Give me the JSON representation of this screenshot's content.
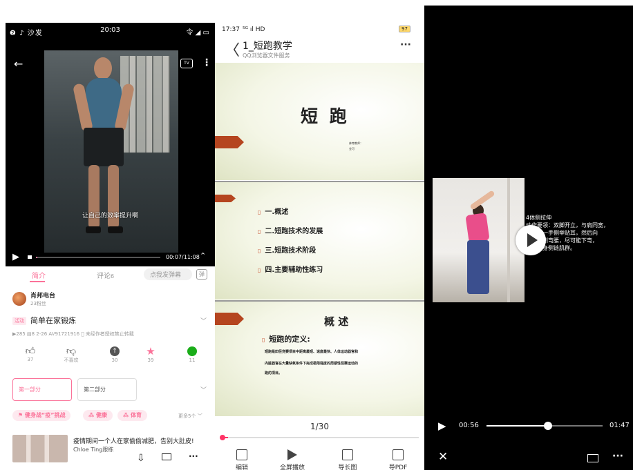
{
  "panel1": {
    "status": {
      "left": "❷ ♪  沙发",
      "time": "20:03",
      "right": "令 ◢ ▭"
    },
    "tv_label": "TV",
    "subtitle": "让自己的效率提升啊",
    "time_display": "00:07/11:08",
    "progress": 0.01,
    "tabs": {
      "intro": "简介",
      "comments": "评论",
      "comments_count": "6",
      "danmaku": "点我发弹幕",
      "danmaku_btn": "弹"
    },
    "uploader": {
      "name": "肖邦电台",
      "fans": "23粉丝"
    },
    "video": {
      "tag": "活动",
      "title": "简单在家锻炼",
      "stats": "▶285  ▤8  2-26  AV91721916  ⃠ 未经作者授权禁止转载"
    },
    "actions": [
      {
        "label": "37",
        "icon": "like-icon",
        "color": "#555"
      },
      {
        "label": "不喜欢",
        "icon": "dislike-icon",
        "color": "#555"
      },
      {
        "label": "30",
        "icon": "coin-icon",
        "color": "#555"
      },
      {
        "label": "39",
        "icon": "favorite-icon",
        "color": "#fb7299"
      },
      {
        "label": "11",
        "icon": "share-icon",
        "color": "#1aad19"
      }
    ],
    "parts": {
      "part1": "第一部分",
      "part2": "第二部分"
    },
    "tags": [
      "健身战“疫”挑战",
      "健康",
      "体育"
    ],
    "more_tags": "更多5个",
    "recommend": {
      "title": "疫情期间一个人在家偷偷减肥，告别大肚皮!",
      "author": "Chloe Ting跟练"
    }
  },
  "panel2": {
    "status": {
      "time": "17:37",
      "signal": "⁵ᴳ ıl HD",
      "battery": "97"
    },
    "title": "1_短跑教学",
    "subtitle": "QQ浏览器文件服务",
    "more": "···",
    "slide1": {
      "title": "短 跑",
      "line1": "体育教师：",
      "line2": "金可"
    },
    "slide2": {
      "items": [
        "一.概述",
        "二.短跑技术的发展",
        "三.短跑技术阶段",
        "四.主要辅助性练习"
      ]
    },
    "slide3": {
      "title": "概 述",
      "heading": "短跑的定义:",
      "body1": "短跑是田径竞赛项目中距离最短、速度最快、人体运动器官和",
      "body2": "内脏器官在大量缺氧条件下完成极限强度的周期性径赛运动的",
      "body3": "跑的项目。"
    },
    "page": "1/30",
    "progress": 0.03,
    "tools": [
      "编辑",
      "全屏播放",
      "导长图",
      "导PDF"
    ]
  },
  "panel3": {
    "caption_title": "4体侧拉伸",
    "caption_lines": [
      "动作要领：双脚开立，与肩同宽，",
      "双手臂一手侧举贴耳，然后向",
      "上向对侧弯腰，尽可能下弯，",
      "拉伸侧身侧链肌群。"
    ],
    "time_current": "00:56",
    "time_total": "01:47",
    "progress": 0.52
  }
}
